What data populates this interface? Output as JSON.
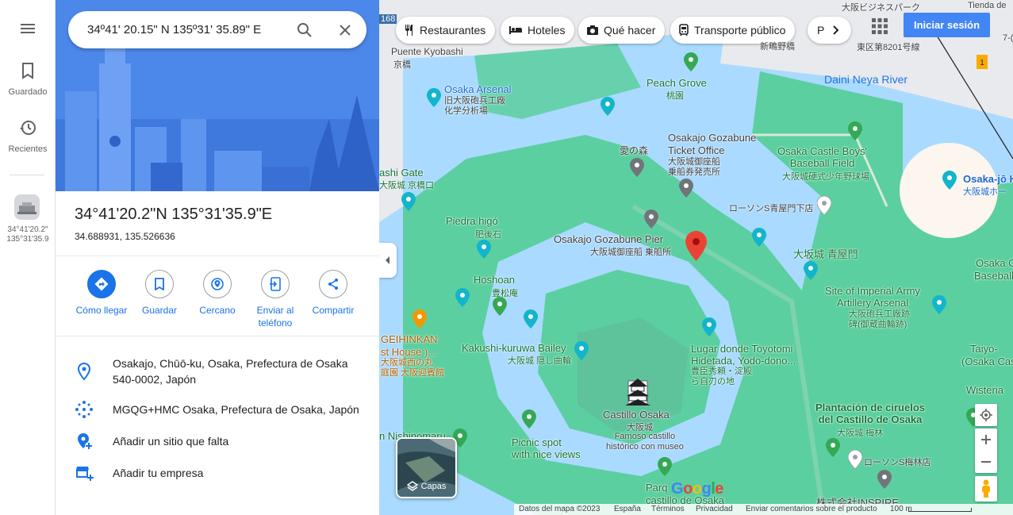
{
  "rail": {
    "menu_icon": "hamburger-menu-icon",
    "saved_label": "Guardado",
    "recent_label": "Recientes",
    "recent_item_line1": "34°41'20.2\"",
    "recent_item_line2": "135°31'35.9"
  },
  "search": {
    "value": "34º41' 20.15\" N 135º31' 35.89\" E"
  },
  "place": {
    "title": "34°41'20.2\"N 135°31'35.9\"E",
    "decimal": "34.688931, 135.526636"
  },
  "actions": [
    {
      "label": "Cómo llegar",
      "icon": "directions-icon"
    },
    {
      "label": "Guardar",
      "icon": "bookmark-icon"
    },
    {
      "label": "Cercano",
      "icon": "nearby-icon"
    },
    {
      "label": "Enviar al teléfono",
      "icon": "send-to-phone-icon"
    },
    {
      "label": "Compartir",
      "icon": "share-icon"
    }
  ],
  "info": {
    "address": "Osakajo, Chūō-ku, Osaka, Prefectura de Osaka 540-0002, Japón",
    "plus_code": "MGQG+HMC Osaka, Prefectura de Osaka, Japón",
    "add_missing": "Añadir un sitio que falta",
    "add_business": "Añadir tu empresa"
  },
  "map": {
    "chips": [
      "Restaurantes",
      "Hoteles",
      "Qué hacer",
      "Transporte público",
      "P"
    ],
    "signin": "Iniciar sesión",
    "layers_label": "Capas",
    "labels": {
      "puente_kyobashi": "Puente Kyobashi",
      "kyobashi_ja": "京橋",
      "osaka_arsenal": "Osaka Arsenal",
      "osaka_arsenal_ja": "旧大阪砲兵工廠\n化学分析場",
      "peach_grove": "Peach Grove",
      "peach_grove_ja": "桃園",
      "daini_neya": "Daini Neya River",
      "gozabune_ticket": "Osakajo Gozabune\nTicket Office",
      "gozabune_ticket_ja": "大阪城御座船\n乗船券発売所",
      "ainomori": "愛の森",
      "baseball": "Osaka Castle Boys'\nBaseball Field",
      "baseball_ja": "大阪城硬式少年野球場",
      "hall": "Osaka-jō H",
      "hall_ja": "大阪城ホー",
      "lawson_aoyamon": "ローソンS青屋門下店",
      "kyobashi_gate": "ashi Gate",
      "kyobashi_gate_ja": "大阪城 京橋口",
      "piedra": "Piedra higó",
      "piedra_ja": "肥後石",
      "pier": "Osakajo Gozabune Pier",
      "pier_ja": "大阪城御座船 乗船所",
      "aoyamon": "大坂城 青屋門",
      "hoshoan": "Hoshoan",
      "hoshoan_ja": "豊松庵",
      "arsenal_site": "Site of Imperial Army\nArtillery Arsenal",
      "arsenal_site_ja": "大阪砲兵工廠跡\n碑(御蔵曲輪跡)",
      "osaka_c": "Osaka C",
      "baseball_r": "Baseball",
      "geihinkan": "GEIHINKAN",
      "guest_house": "st House )...",
      "geihinkan_ja": "大阪城西の丸\n庭園 大阪迎賓館",
      "kakushi": "Kakushi-kuruwa Bailey",
      "kakushi_ja": "大阪城 隠し曲輪",
      "toyotomi": "Lugar donde Toyotomi\nHidetada, Yodo-dono...",
      "toyotomi_ja": "豊臣秀頼・淀殿\nら自刃の地",
      "taiyo": "Taiyo-",
      "osaka_cas": "(Osaka Cas",
      "wisteria": "Wisteria",
      "castillo": "Castillo Osaka",
      "castillo_ja": "大阪城",
      "castillo_desc": "Famoso castillo\nhistórico con museo",
      "plum": "Plantación de ciruelos\ndel Castillo de Osaka",
      "plum_ja": "大阪城 梅林",
      "nishinomaru": "n Nishinomaru",
      "picnic": "Picnic spot\nwith nice views",
      "lawson_bairin": "ローソンS梅林店",
      "parque": "Parq",
      "parque2": "castillo de Osaka",
      "inspire": "株式会社INSPIRE",
      "business_park": "大阪ビジネスパーク",
      "road_no": "東区第8201号線",
      "station_ja": "新鴫野橋",
      "tienda": "Tienda de",
      "seven": "7-(",
      "route_168": "168"
    },
    "footer": {
      "mapdata": "Datos del mapa ©2023",
      "country": "España",
      "terms": "Términos",
      "privacy": "Privacidad",
      "feedback": "Enviar comentarios sobre el producto",
      "scale": "100 m"
    },
    "logo": "Google"
  },
  "colors": {
    "accent": "#1a73e8",
    "water": "#aadaff",
    "park": "#5ccfa0",
    "pin": "#ea4335",
    "signin": "#4285f4"
  }
}
